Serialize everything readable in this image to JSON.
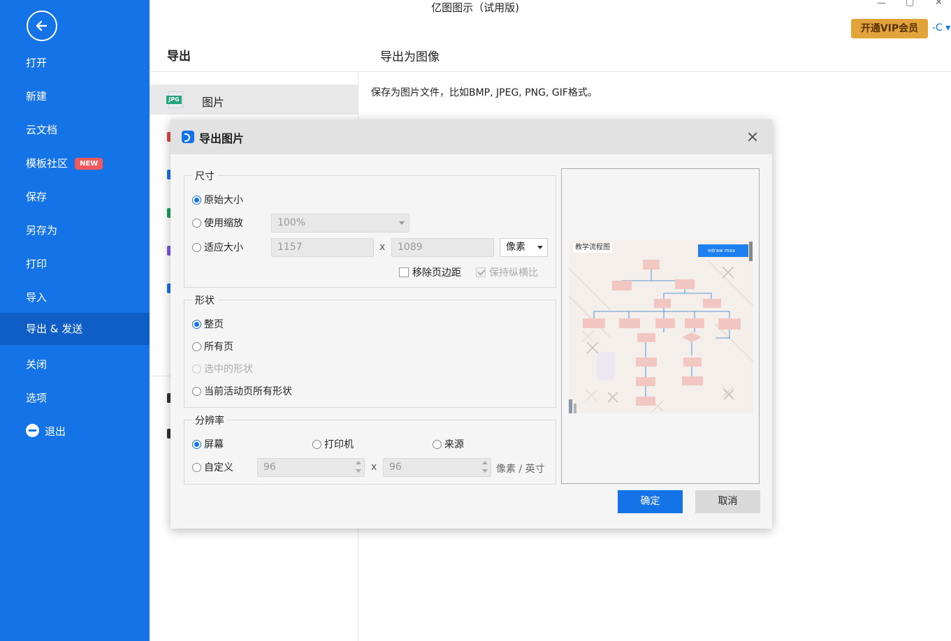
{
  "app": {
    "title": "亿图图示（试用版)",
    "vip_label": "开通VIP会员",
    "user_label": "-C ▾"
  },
  "sidebar": {
    "items": [
      {
        "label": "打开"
      },
      {
        "label": "新建"
      },
      {
        "label": "云文档"
      },
      {
        "label": "模板社区",
        "badge": "NEW"
      },
      {
        "label": "保存"
      },
      {
        "label": "另存为"
      },
      {
        "label": "打印"
      },
      {
        "label": "导入"
      },
      {
        "label": "导出 & 发送",
        "active": true
      },
      {
        "label": "关闭"
      },
      {
        "label": "选项"
      },
      {
        "label": "退出"
      }
    ]
  },
  "export_panel": {
    "title": "导出",
    "subtitle": "导出为图像",
    "list": [
      {
        "label": "图片",
        "icon_text": "JPG"
      }
    ],
    "description": "保存为图片文件，比如BMP, JPEG, PNG, GIF格式。"
  },
  "dialog": {
    "title": "导出图片",
    "size": {
      "legend": "尺寸",
      "original": "原始大小",
      "use_zoom": "使用缩放",
      "zoom_value": "100%",
      "fit_size": "适应大小",
      "width": "1157",
      "x": "x",
      "height": "1089",
      "unit": "像素",
      "remove_margin": "移除页边距",
      "keep_ratio": "保持纵横比"
    },
    "shape": {
      "legend": "形状",
      "whole_page": "整页",
      "all_pages": "所有页",
      "selected": "选中的形状",
      "active_page_all": "当前活动页所有形状"
    },
    "resolution": {
      "legend": "分辨率",
      "screen": "屏幕",
      "printer": "打印机",
      "source": "来源",
      "custom": "自定义",
      "dpi_x": "96",
      "x": "x",
      "dpi_y": "96",
      "unit": "像素 / 英寸"
    },
    "preview": {
      "thumb_title": "教学流程图",
      "brand": "edraw max"
    },
    "ok": "确定",
    "cancel": "取消"
  },
  "colors": {
    "primary": "#1473e6",
    "sidebar_active": "#0f5ec7",
    "vip": "#e2a43a",
    "badge": "#f0595b"
  }
}
